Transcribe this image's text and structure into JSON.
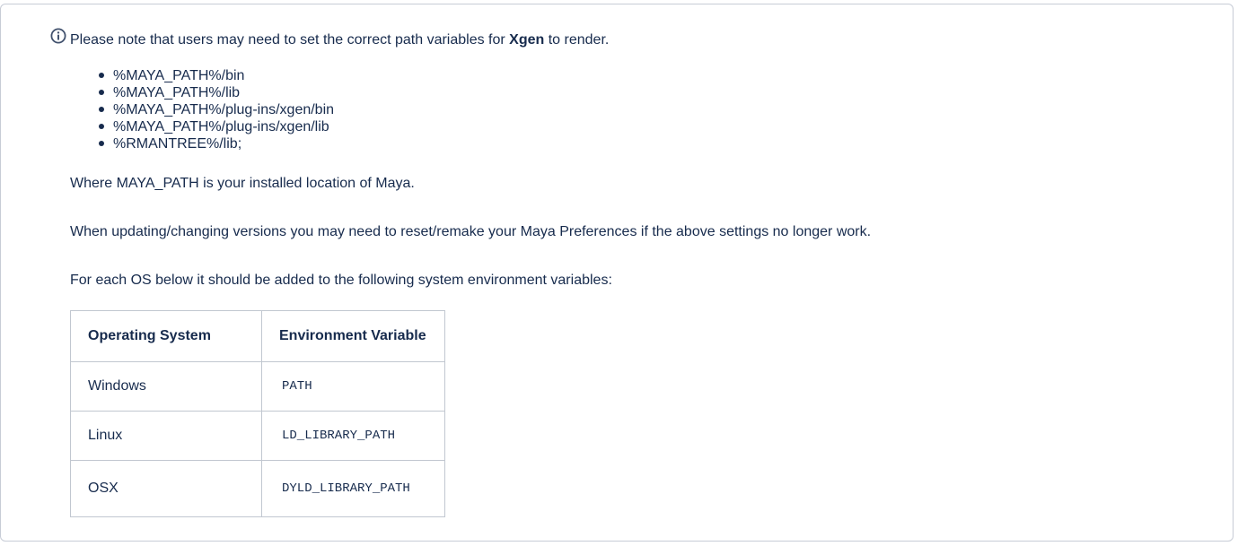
{
  "info_panel": {
    "icon": "info-icon",
    "accent_color": "#42526e",
    "note_prefix": "Please note that users may need to set the correct path variables for ",
    "note_bold": "Xgen",
    "note_suffix": " to render.",
    "paths": [
      "%MAYA_PATH%/bin",
      "%MAYA_PATH%/lib",
      "%MAYA_PATH%/plug-ins/xgen/bin",
      "%MAYA_PATH%/plug-ins/xgen/lib",
      "%RMANTREE%/lib;"
    ],
    "para_where": "Where MAYA_PATH is your installed location of Maya.",
    "para_updating": "When updating/changing versions you may need to reset/remake your Maya Preferences if the above settings no longer work.",
    "para_each_os": "For each OS below it should be added to the following system environment variables:",
    "table": {
      "headers": [
        "Operating System",
        "Environment Variable"
      ],
      "rows": [
        [
          "Windows",
          "PATH"
        ],
        [
          "Linux",
          "LD_LIBRARY_PATH"
        ],
        [
          "OSX",
          "DYLD_LIBRARY_PATH"
        ]
      ]
    }
  }
}
